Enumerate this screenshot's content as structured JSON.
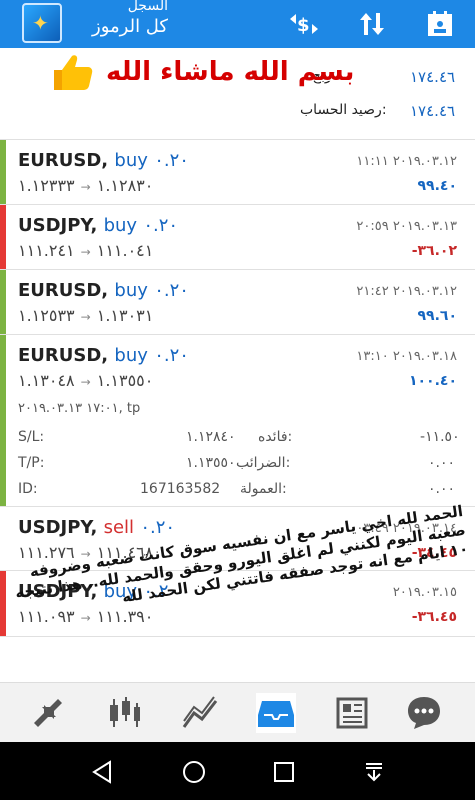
{
  "topbar": {
    "title_small": "السجل",
    "title_big": "كل الرموز",
    "icons": [
      "app-logo-icon",
      "currency-exchange-icon",
      "sort-icon",
      "calendar-icon"
    ]
  },
  "balance": {
    "profit_label": "ربح:",
    "profit_value": "١٧٤.٤٦",
    "account_label": "رصيد الحساب:",
    "account_value": "١٧٤.٤٦",
    "overlay_text": "بسم الله ماشاء الله"
  },
  "trades": [
    {
      "symbol": "EURUSD,",
      "type": "buy",
      "volume": "٠.٢٠",
      "open": "١.١٢٨٣٠",
      "close": "١.١٢٣٣٣",
      "date": "٢٠١٩.٠٣.١٢ ١١:١١",
      "profit": "٩٩.٤٠",
      "status": "positive"
    },
    {
      "symbol": "USDJPY,",
      "type": "buy",
      "volume": "٠.٢٠",
      "open": "١١١.٠٤١",
      "close": "١١١.٢٤١",
      "date": "٢٠١٩.٠٣.١٣ ٢٠:٥٩",
      "profit": "-٣٦.٠٢",
      "status": "negative"
    },
    {
      "symbol": "EURUSD,",
      "type": "buy",
      "volume": "٠.٢٠",
      "open": "١.١٣٠٣١",
      "close": "١.١٢٥٣٣",
      "date": "٢٠١٩.٠٣.١٢ ٢١:٤٢",
      "profit": "٩٩.٦٠",
      "status": "positive"
    },
    {
      "symbol": "EURUSD,",
      "type": "buy",
      "volume": "٠.٢٠",
      "open": "١.١٣٥٥٠",
      "close": "١.١٣٠٤٨",
      "date": "٢٠١٩.٠٣.١٨ ١٣:١٠",
      "profit": "١٠٠.٤٠",
      "status": "positive"
    },
    {
      "symbol": "USDJPY,",
      "type": "sell",
      "volume": "٠.٢٠",
      "open": "١١١.٤٦٨",
      "close": "١١١.٢٧٦",
      "date": "٢٠١٩.٠٣.١٤ ٠٣:٤٩",
      "profit": "-٣٤.٤٥",
      "status": "negative"
    },
    {
      "symbol": "USDJPY,",
      "type": "buy",
      "volume": "٠.٢٠",
      "open": "١١١.٣٩٠",
      "close": "١١١.٠٩٣",
      "date": "٢٠١٩.٠٣.١٥",
      "profit": "-٣٦.٤٥",
      "status": "negative"
    }
  ],
  "expanded": {
    "close_info": "١٧:٠١ ٢٠١٩.٠٣.١٣, tp",
    "sl_label": "S/L:",
    "sl_value": "١.١٢٨٤٠",
    "tp_label": "T/P:",
    "tp_value": "١.١٣٥٥٠",
    "id_label": "ID:",
    "id_value": "167163582",
    "interest_label": "فائده:",
    "interest_value": "-١١.٥٠",
    "taxes_label": "الضرائب:",
    "taxes_value": "٠.٠٠",
    "commission_label": "العمولة:",
    "commission_value": "٠.٠٠"
  },
  "overlay_message": "الحمد لله اخي ياسر مع ان نفسيه سوق كانت صعبه وضروفه صعبه اليوم لكنني لم اغلق اليورو وحقق والحمد لله.. هذا نتيجه ١٠ ايام مع انه توجد صفقه فاتتني لكن الحمد لله",
  "bottombar": [
    "trade-icon",
    "chart-icon",
    "analytics-icon",
    "history-icon",
    "news-icon",
    "chat-icon"
  ],
  "colors": {
    "accent": "#1e88e5",
    "profit": "#1565c0",
    "loss": "#c62828",
    "buy_bar": "#7cb342",
    "loss_bar": "#e53935"
  }
}
